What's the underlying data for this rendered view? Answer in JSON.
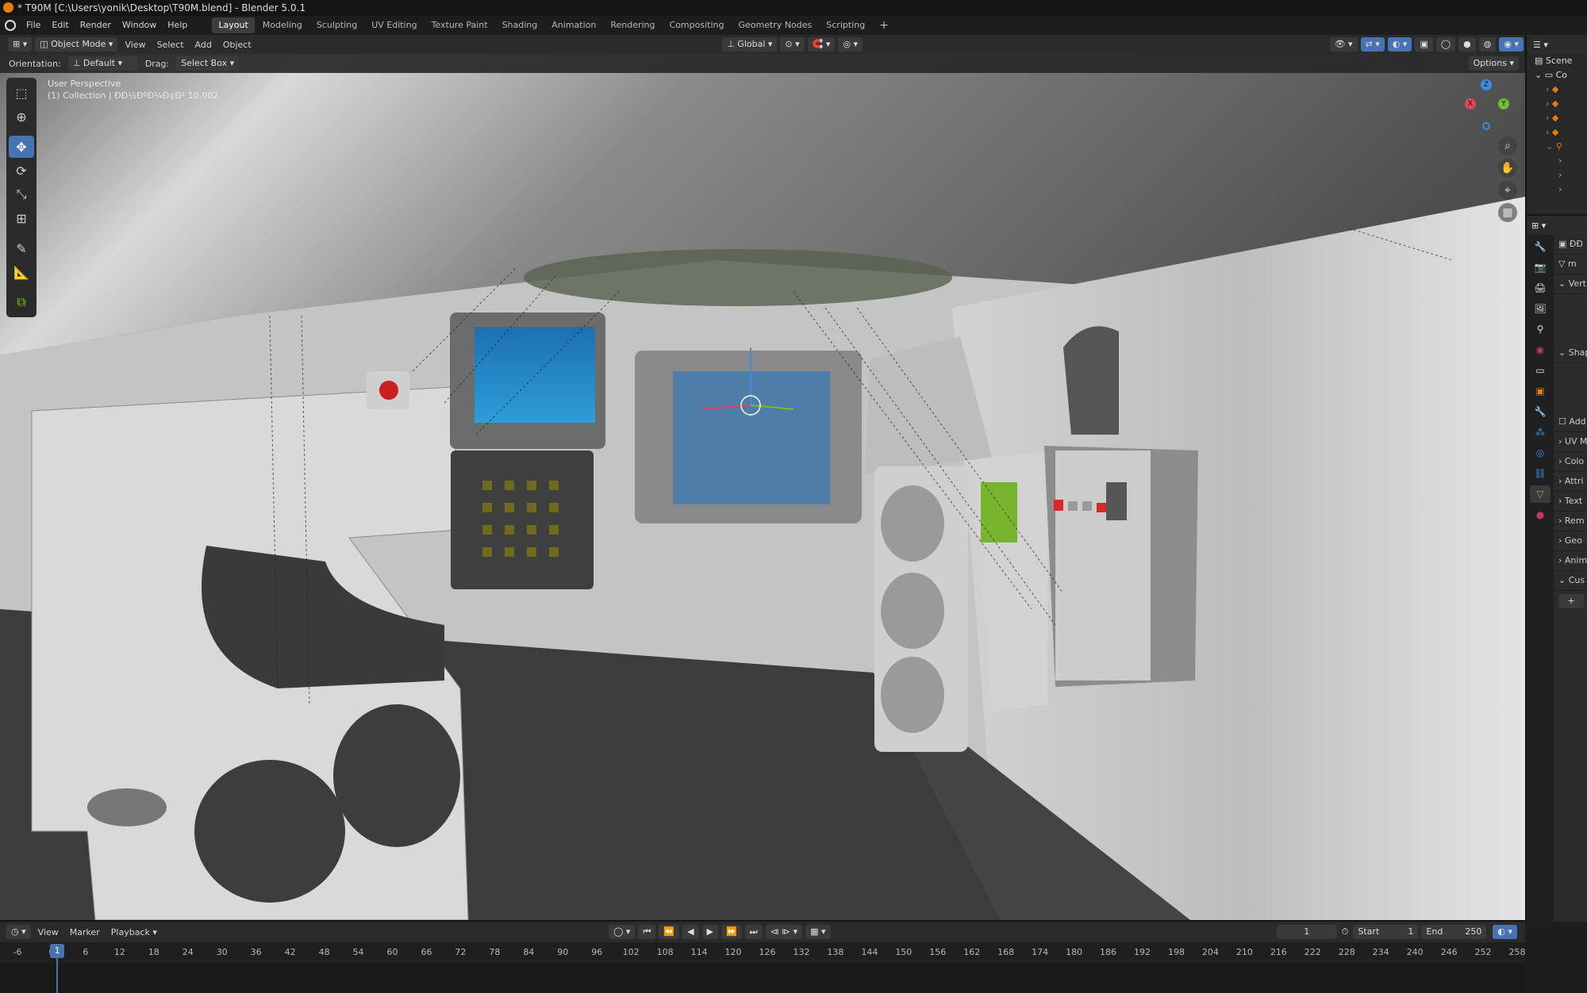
{
  "window": {
    "title": "* T90M [C:\\Users\\yonik\\Desktop\\T90M.blend] - Blender 5.0.1"
  },
  "menu": [
    "File",
    "Edit",
    "Render",
    "Window",
    "Help"
  ],
  "workspaces": [
    "Layout",
    "Modeling",
    "Sculpting",
    "UV Editing",
    "Texture Paint",
    "Shading",
    "Animation",
    "Rendering",
    "Compositing",
    "Geometry Nodes",
    "Scripting"
  ],
  "workspace_add": "+",
  "header": {
    "mode": "Object Mode",
    "menus": [
      "View",
      "Select",
      "Add",
      "Object"
    ],
    "transform_space": "Global"
  },
  "tool_settings": {
    "orientation_label": "Orientation:",
    "orientation_value": "Default",
    "drag_label": "Drag:",
    "drag_value": "Select Box",
    "options": "Options"
  },
  "viewport": {
    "perspective": "User Perspective",
    "collection_info": "(1) Collection | ÐÐ½ÐºÐ¼Ð¢Ð¹ 10.002"
  },
  "gizmo": {
    "x": "X",
    "y": "Y",
    "z": "Z"
  },
  "outliner": {
    "scene": "Scene",
    "collection": "Co"
  },
  "properties": {
    "object": "ÐÐ",
    "data": "m",
    "sections": [
      "Vert",
      "Shap",
      "Add",
      "UV M",
      "Colo",
      "Attri",
      "Text",
      "Rem",
      "Geo",
      "Anim",
      "Cus"
    ],
    "add": "+"
  },
  "timeline": {
    "menus": [
      "View",
      "Marker",
      "Playback"
    ],
    "current_frame": "1",
    "start_label": "Start",
    "start": "1",
    "end_label": "End",
    "end": "250",
    "marker_frame": "1",
    "ticks": [
      "-6",
      "0",
      "6",
      "12",
      "18",
      "24",
      "30",
      "36",
      "42",
      "48",
      "54",
      "60",
      "66",
      "72",
      "78",
      "84",
      "90",
      "96",
      "102",
      "108",
      "114",
      "120",
      "126",
      "132",
      "138",
      "144",
      "150",
      "156",
      "162",
      "168",
      "174",
      "180",
      "186",
      "192",
      "198",
      "204",
      "210",
      "216",
      "222",
      "228",
      "234",
      "240",
      "246",
      "252",
      "258"
    ]
  },
  "colors": {
    "accent": "#4772b3",
    "x_axis": "#e0455a",
    "y_axis": "#6fbf2f",
    "z_axis": "#3b8de0",
    "screen": "#2a86c8"
  }
}
